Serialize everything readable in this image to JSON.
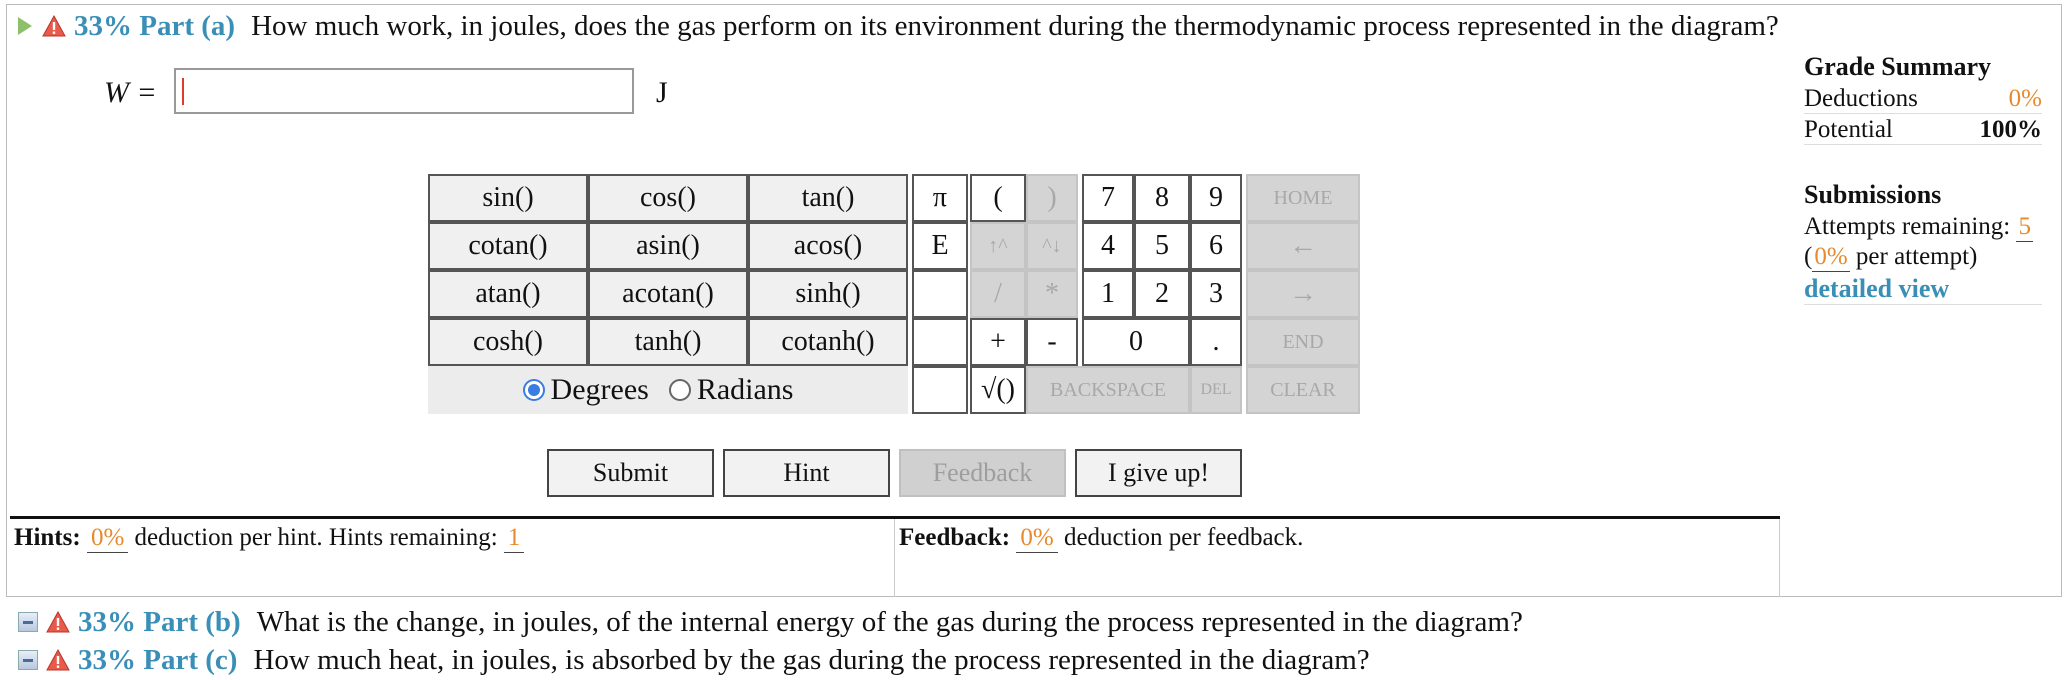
{
  "part_a": {
    "percent": "33%",
    "label": "Part (a)",
    "question": "How much work, in joules, does the gas perform on its environment during the thermodynamic process represented in the diagram?"
  },
  "answer": {
    "variable": "W =",
    "value": "",
    "unit": "J"
  },
  "keypad": {
    "functions": [
      [
        "sin()",
        "cos()",
        "tan()"
      ],
      [
        "cotan()",
        "asin()",
        "acos()"
      ],
      [
        "atan()",
        "acotan()",
        "sinh()"
      ],
      [
        "cosh()",
        "tanh()",
        "cotanh()"
      ]
    ],
    "pi": "π",
    "e": "E",
    "open_paren": "(",
    "close_paren": ")",
    "up_caret": "↑^",
    "down_caret": "^↓",
    "divide": "/",
    "multiply": "*",
    "plus": "+",
    "minus": "-",
    "digits_row1": [
      "7",
      "8",
      "9"
    ],
    "digits_row2": [
      "4",
      "5",
      "6"
    ],
    "digits_row3": [
      "1",
      "2",
      "3"
    ],
    "zero": "0",
    "dot": ".",
    "sqrt": "√()",
    "home": "HOME",
    "left": "←",
    "right": "→",
    "end": "END",
    "backspace": "BACKSPACE",
    "del": "DEL",
    "clear": "CLEAR",
    "degrees": "Degrees",
    "radians": "Radians"
  },
  "buttons": {
    "submit": "Submit",
    "hint": "Hint",
    "feedback": "Feedback",
    "give_up": "I give up!"
  },
  "hints": {
    "label": "Hints:",
    "pct": "0%",
    "text": "deduction per hint. Hints remaining:",
    "remaining": "1"
  },
  "feedback": {
    "label": "Feedback:",
    "pct": "0%",
    "text": "deduction per feedback."
  },
  "grade_summary": {
    "title": "Grade Summary",
    "deductions_label": "Deductions",
    "deductions_value": "0%",
    "potential_label": "Potential",
    "potential_value": "100%"
  },
  "submissions": {
    "title": "Submissions",
    "attempts_label": "Attempts remaining:",
    "attempts_value": "5",
    "per_attempt_open": "(",
    "per_attempt_pct": "0%",
    "per_attempt_text": "per attempt)",
    "detailed_view": "detailed view"
  },
  "part_b": {
    "percent": "33%",
    "label": "Part (b)",
    "question": "What is the change, in joules, of the internal energy of the gas during the process represented in the diagram?"
  },
  "part_c": {
    "percent": "33%",
    "label": "Part (c)",
    "question": "How much heat, in joules, is absorbed by the gas during the process represented in the diagram?"
  },
  "colors": {
    "accent_blue": "#3a8fb7",
    "orange": "#e68a2e",
    "radio_blue": "#3b7ce0"
  }
}
